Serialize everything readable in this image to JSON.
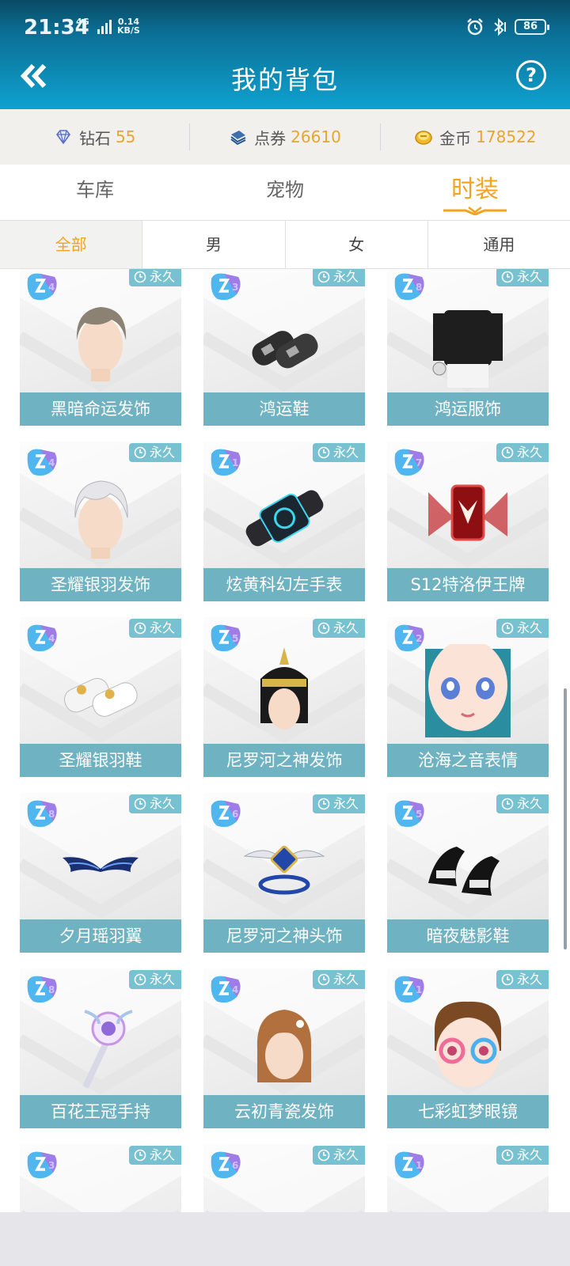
{
  "status": {
    "time": "21:34",
    "network": "4G",
    "speed": "0.14",
    "speed_unit": "KB/S",
    "battery": "86"
  },
  "header": {
    "title": "我的背包",
    "help": "?"
  },
  "currency": {
    "diamond_label": "钻石",
    "diamond_value": "55",
    "coupon_label": "点券",
    "coupon_value": "26610",
    "gold_label": "金币",
    "gold_value": "178522"
  },
  "category_tabs": [
    "车库",
    "宠物",
    "时装"
  ],
  "sub_tabs": [
    "全部",
    "男",
    "女",
    "通用"
  ],
  "permanent_label": "永久",
  "items": [
    {
      "name": "黑暗命运发饰",
      "level": "4",
      "art": "hair-dark"
    },
    {
      "name": "鸿运鞋",
      "level": "3",
      "art": "shoes-black"
    },
    {
      "name": "鸿运服饰",
      "level": "8",
      "art": "outfit"
    },
    {
      "name": "圣耀银羽发饰",
      "level": "4",
      "art": "hair-silver"
    },
    {
      "name": "炫黄科幻左手表",
      "level": "1",
      "art": "watch"
    },
    {
      "name": "S12特洛伊王牌",
      "level": "7",
      "art": "card-red"
    },
    {
      "name": "圣耀银羽鞋",
      "level": "4",
      "art": "shoes-white"
    },
    {
      "name": "尼罗河之神发饰",
      "level": "5",
      "art": "hair-egypt"
    },
    {
      "name": "沧海之音表情",
      "level": "2",
      "art": "face"
    },
    {
      "name": "夕月瑶羽翼",
      "level": "8",
      "art": "wings"
    },
    {
      "name": "尼罗河之神头饰",
      "level": "6",
      "art": "headpiece"
    },
    {
      "name": "暗夜魅影鞋",
      "level": "5",
      "art": "heels"
    },
    {
      "name": "百花王冠手持",
      "level": "8",
      "art": "wand"
    },
    {
      "name": "云初青瓷发饰",
      "level": "4",
      "art": "hair-brown"
    },
    {
      "name": "七彩虹梦眼镜",
      "level": "1",
      "art": "glasses"
    },
    {
      "name": "",
      "level": "3",
      "art": "hair-partial"
    },
    {
      "name": "",
      "level": "6",
      "art": "bag-partial"
    },
    {
      "name": "",
      "level": "1",
      "art": "hair-bow-partial"
    }
  ],
  "colors": {
    "header_top": "#0a4a64",
    "header_bottom": "#0fa2cf",
    "accent_orange": "#f3a31f",
    "item_label_bg": "#6fb2c1",
    "permanent_tag_bg": "#78c1d0"
  }
}
